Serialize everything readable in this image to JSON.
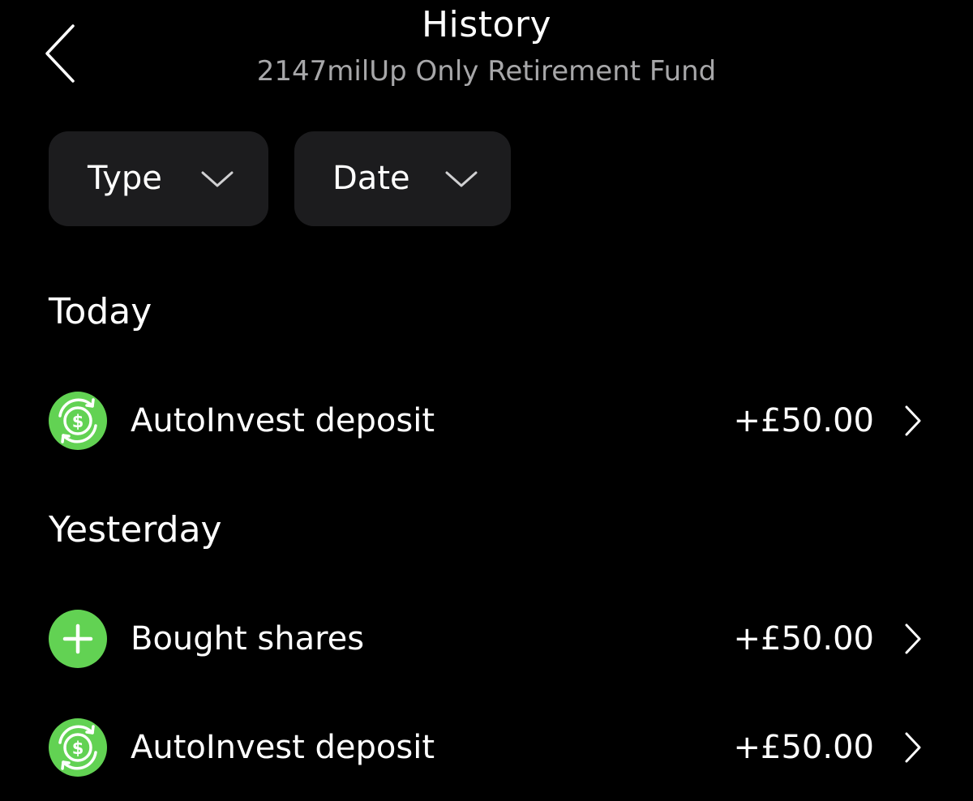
{
  "header": {
    "title": "History",
    "subtitle": "2147milUp Only Retirement Fund",
    "back_icon": "chevron-left-icon"
  },
  "filters": [
    {
      "label": "Type",
      "icon": "chevron-down-icon"
    },
    {
      "label": "Date",
      "icon": "chevron-down-icon"
    }
  ],
  "sections": [
    {
      "heading": "Today",
      "items": [
        {
          "label": "AutoInvest deposit",
          "amount": "+£50.00",
          "icon": "recurring-dollar-icon"
        }
      ]
    },
    {
      "heading": "Yesterday",
      "items": [
        {
          "label": "Bought shares",
          "amount": "+£50.00",
          "icon": "plus-icon"
        },
        {
          "label": "AutoInvest deposit",
          "amount": "+£50.00",
          "icon": "recurring-dollar-icon"
        }
      ]
    }
  ],
  "colors": {
    "background": "#000000",
    "surface": "#1c1c1e",
    "accent_green": "#62d253",
    "text_primary": "#ffffff",
    "text_secondary": "#a7a7a9"
  }
}
